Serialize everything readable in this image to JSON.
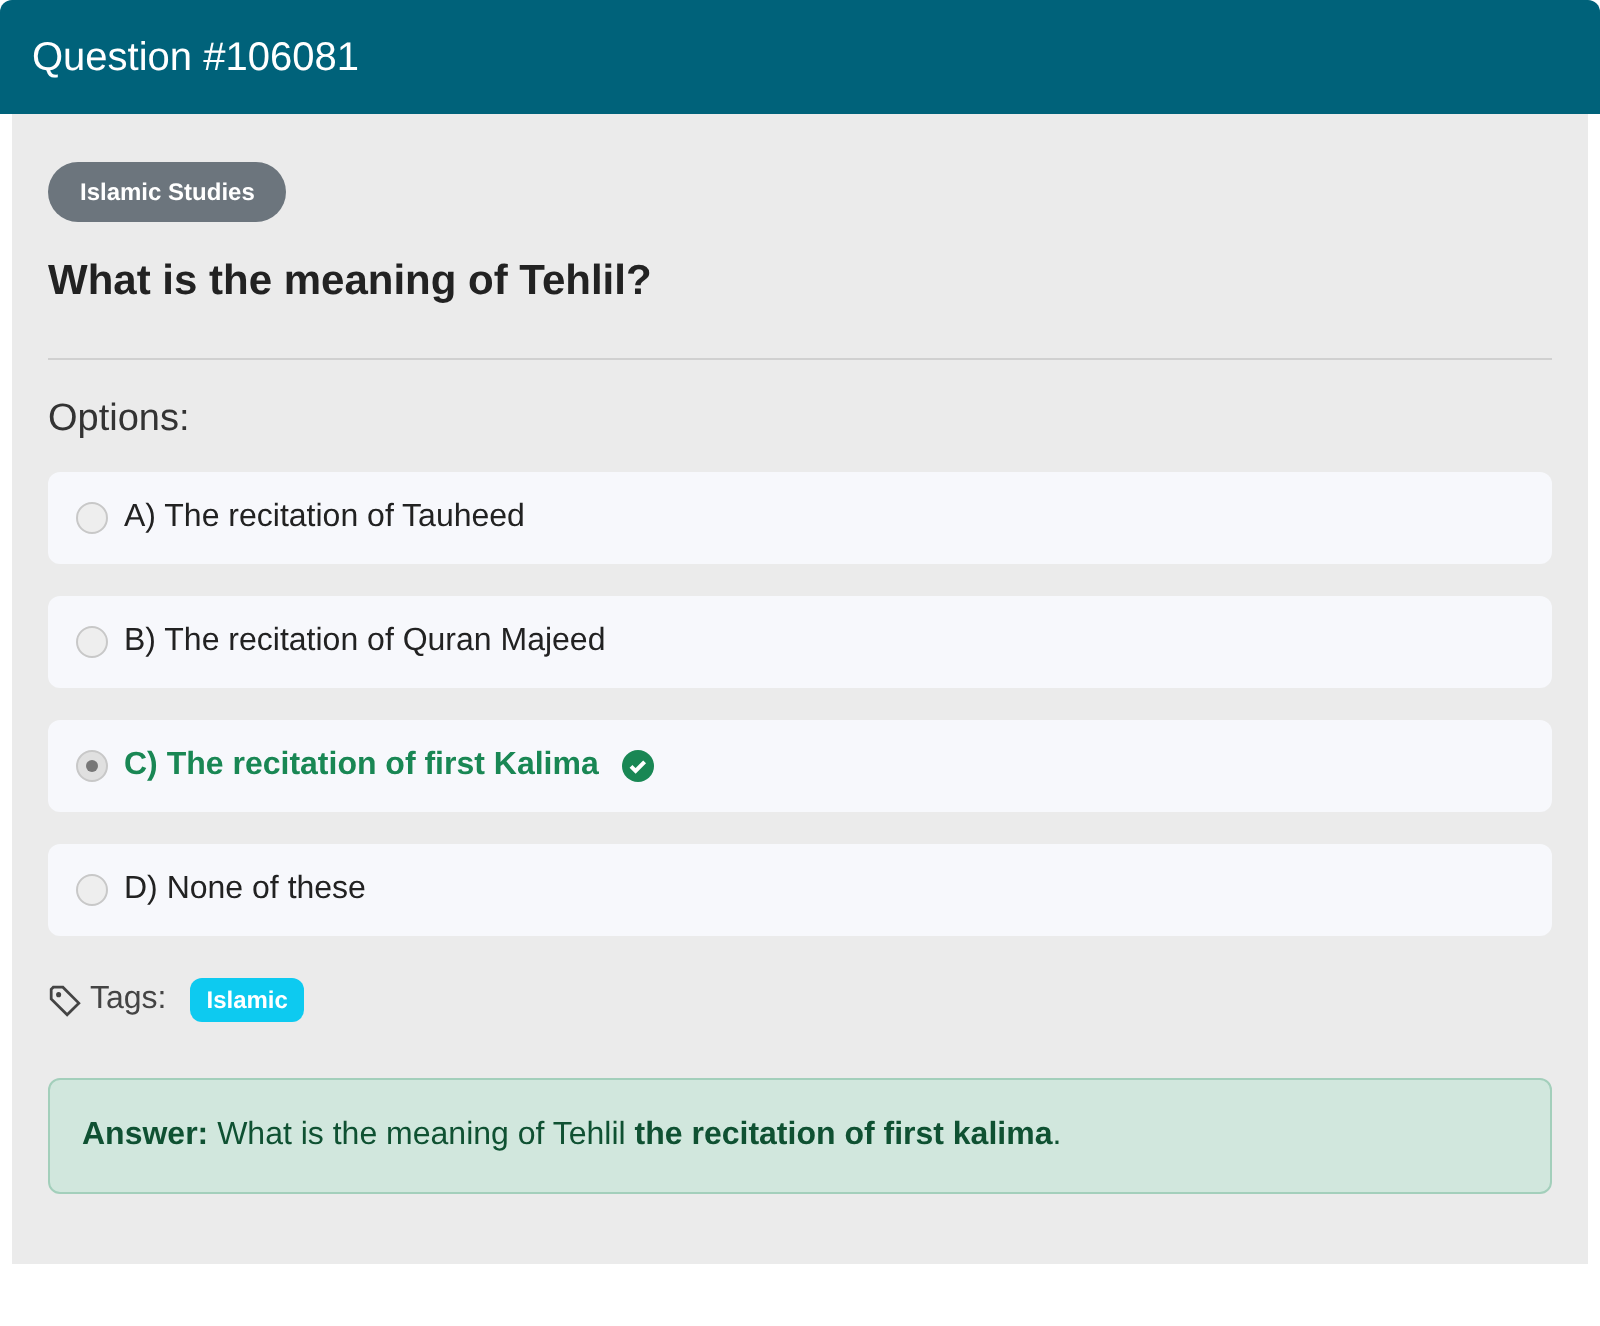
{
  "header": {
    "title": "Question #106081"
  },
  "category": "Islamic Studies",
  "question": "What is the meaning of Tehlil?",
  "options_label": "Options:",
  "options": [
    {
      "text": "A) The recitation of Tauheed",
      "selected": false,
      "correct": false
    },
    {
      "text": "B) The recitation of Quran Majeed",
      "selected": false,
      "correct": false
    },
    {
      "text": "C) The recitation of first Kalima",
      "selected": true,
      "correct": true
    },
    {
      "text": "D) None of these",
      "selected": false,
      "correct": false
    }
  ],
  "tags_label": "Tags:",
  "tags": [
    "Islamic"
  ],
  "answer": "**Answer:** What is the meaning of Tehlil **the recitation of first kalima**."
}
